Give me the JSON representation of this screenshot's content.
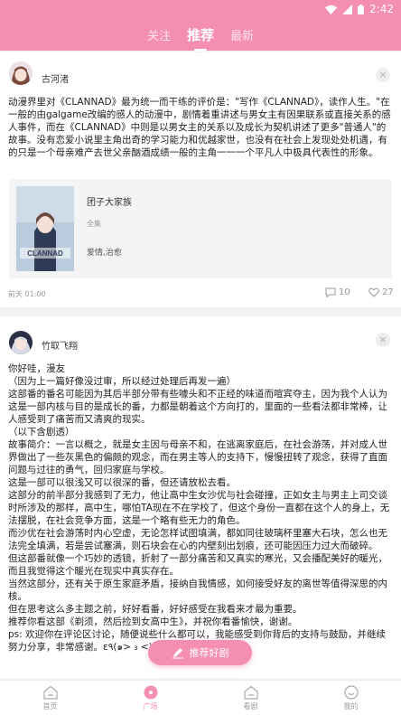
{
  "status_bar": {
    "time": "2:42"
  },
  "top_tabs": [
    {
      "label": "关注",
      "active": false
    },
    {
      "label": "推荐",
      "active": true
    },
    {
      "label": "最新",
      "active": false
    }
  ],
  "posts": [
    {
      "username": "古河渚",
      "text": "动漫界里对《CLANNAD》最为统一而干练的评价是：\"写作《CLANNAD》，读作人生。\"在一般的由galgame改编的感人的动漫中，剧情着重讲述与男女主有因果联系或直接关系的感人事件，而在《CLANNAD》中则是以男女主的关系以及成长为契机讲述了更多\"普通人\"的故事。没有恋爱小说里主角出奇的学习能力和优越家世，也没有在社会上发现处处机遇，有的只是一个母亲难产去世父亲酗酒成绩一般的主角一一一个平凡人中极具代表性的形象。",
      "work": {
        "title": "团子大家族",
        "type": "全集",
        "tags": "爱情,治愈",
        "cover_text": "CLANNAD"
      },
      "time": "前天 01:00",
      "comments": "10",
      "likes": "27"
    },
    {
      "username": "竹取飞翔",
      "text": "你好哇，漫友\n（因为上一篇好像没过审，所以经过处理后再发一遍）\n这部番的番名可能因为其后半部分带有些噱头和不正经的味道而喧宾夺主，因为我个人认为这是一部内核与目的是成长的番，力都是朝着这个方向打的，里面的一些看法都非常棒，让人感受到了痛苦而又清爽的现实。\n（以下含剧透）\n故事简介：一言以概之，就是女主因与母亲不和，在逃离家庭后，在社会游荡，并对成人世界做出了一些灰黑色的偏颇的观念，而在男主等人的支持下，慢慢扭转了观念，获得了直面问题与过往的勇气，回归家庭与学校。\n这是一部可以很浅又可以很深的番，但还请放松去看。\n这部分的前半部分我感到了无力，他让高中生女沙优与社会碰撞，正如女主与男主上司交谈时所涉及的那样，高中生，哪怕TA现在不在学校了，但这个身份一直都在这个人的身上，无法摆脱，在社会竞争方面，这是一个略有些无力的角色。\n而沙优在社会游荡时内心空虚，无论怎样试图填满，都如同往玻璃杯里塞大石块，怎么也无法完全填满，若是尝试塞满，则石块会在心的内壁刻出划痕，还可能因压力过大而破碎。\n但这部番就像一个巧妙的透镜，折射了一部分痛苦和又真实的寒光，又会播配美好的暖光，而且我觉得这个暖光在现实中真实存在。\n当然这部分，还有关于原生家庭矛盾，接纳自我情感，如何接受好友的离世等值得深思的内核。\n但在思考这么多主题之前，好好看番，好好感受在我看来才最为重要。\n推荐你看这部《剃须，然后捡到女高中生》，并祝你看番愉快，谢谢。\nps: 欢迎你在评论区讨论，随便说些什么都可以，我能感受到你背后的支持与鼓励，并继续努力分享，非常感谢。ε٩(๑> ₃ <)۶з"
    }
  ],
  "fab": {
    "label": "推荐好剧"
  },
  "bottom_nav": [
    {
      "label": "首页",
      "active": false
    },
    {
      "label": "广场",
      "active": true
    },
    {
      "label": "看剧",
      "active": false
    },
    {
      "label": "我的",
      "active": false
    }
  ],
  "colors": {
    "accent": "#f48fb1",
    "background": "#f2f2f2"
  }
}
